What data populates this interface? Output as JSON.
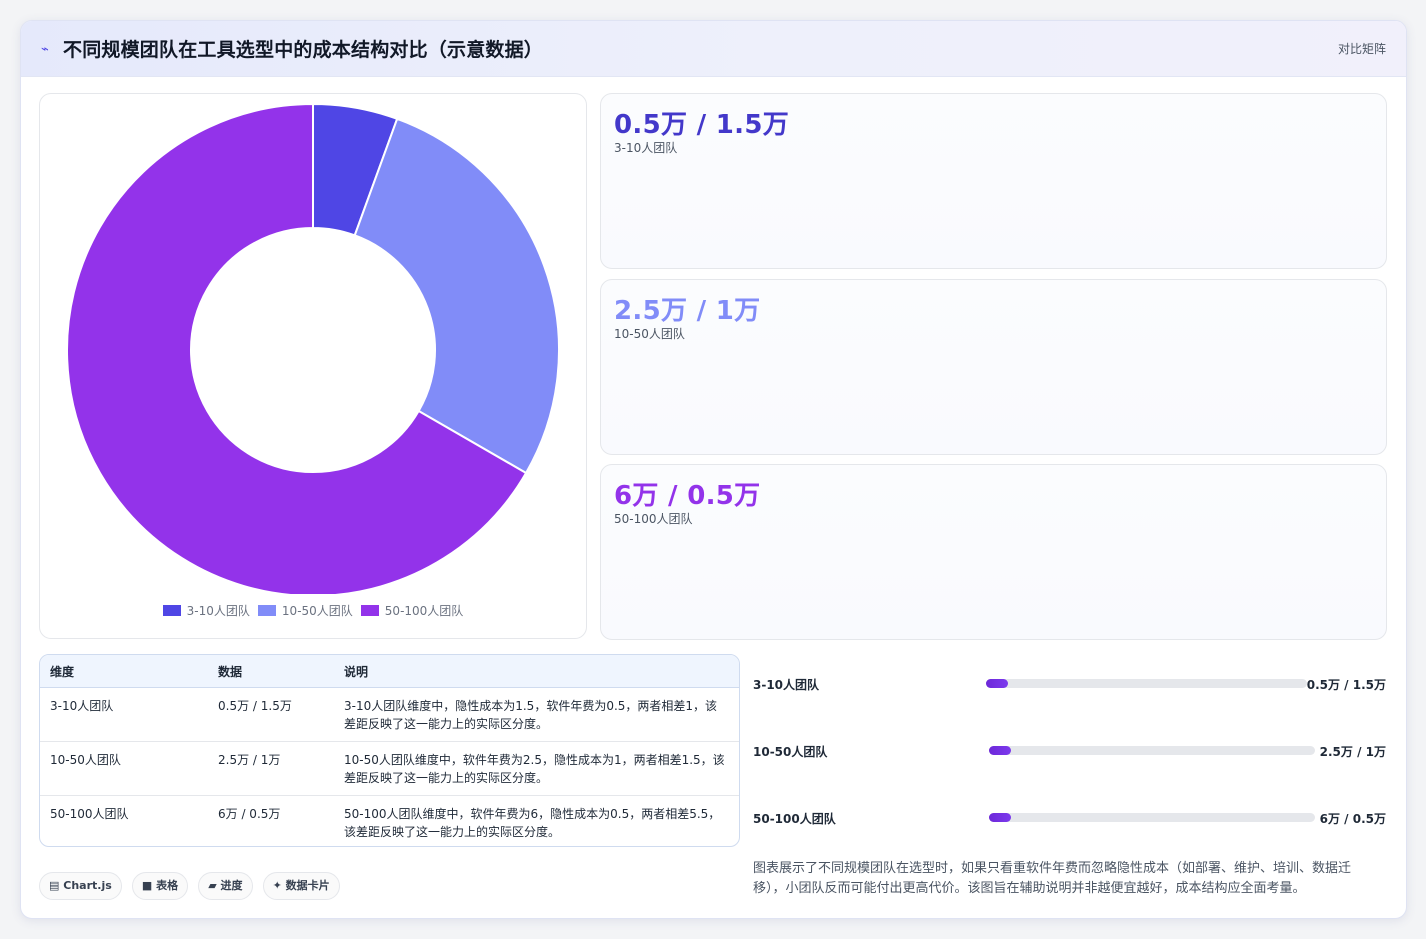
{
  "header": {
    "icon": "chart-line-icon",
    "title": "不同规模团队在工具选型中的成本结构对比（示意数据）",
    "tag": "对比矩阵"
  },
  "chart_data": {
    "type": "pie",
    "categories": [
      "3-10人团队",
      "10-50人团队",
      "50-100人团队"
    ],
    "values": [
      0.5,
      2.5,
      6
    ],
    "colors": [
      "#4f46e5",
      "#818cf8",
      "#9333ea"
    ],
    "legend": "bottom"
  },
  "cards": [
    {
      "value": "0.5万 / 1.5万",
      "label": "3-10人团队",
      "color": "#4338ca"
    },
    {
      "value": "2.5万 / 1万",
      "label": "10-50人团队",
      "color": "#818cf8"
    },
    {
      "value": "6万 / 0.5万",
      "label": "50-100人团队",
      "color": "#9333ea"
    }
  ],
  "table": {
    "headers": [
      "维度",
      "数据",
      "说明"
    ],
    "rows": [
      [
        "3-10人团队",
        "0.5万 / 1.5万",
        "3-10人团队维度中，隐性成本为1.5，软件年费为0.5，两者相差1，该差距反映了这一能力上的实际区分度。"
      ],
      [
        "10-50人团队",
        "2.5万 / 1万",
        "10-50人团队维度中，软件年费为2.5，隐性成本为1，两者相差1.5，该差距反映了这一能力上的实际区分度。"
      ],
      [
        "50-100人团队",
        "6万 / 0.5万",
        "50-100人团队维度中，软件年费为6，隐性成本为0.5，两者相差5.5，该差距反映了这一能力上的实际区分度。"
      ]
    ]
  },
  "progress": [
    {
      "label": "3-10人团队",
      "value": "0.5万 / 1.5万",
      "fraction": 0.067
    },
    {
      "label": "10-50人团队",
      "value": "2.5万 / 1万",
      "fraction": 0.067
    },
    {
      "label": "50-100人团队",
      "value": "6万 / 0.5万",
      "fraction": 0.067
    }
  ],
  "chips": [
    {
      "icon": "chart-icon",
      "glyph": "▤",
      "label": "Chart.js"
    },
    {
      "icon": "table-icon",
      "glyph": "■",
      "label": "表格"
    },
    {
      "icon": "progress-icon",
      "glyph": "▰",
      "label": "进度"
    },
    {
      "icon": "sparkle-icon",
      "glyph": "✦",
      "label": "数据卡片"
    }
  ],
  "note": "图表展示了不同规模团队在选型时，如果只看重软件年费而忽略隐性成本（如部署、维护、培训、数据迁移），小团队反而可能付出更高代价。该图旨在辅助说明并非越便宜越好，成本结构应全面考量。"
}
